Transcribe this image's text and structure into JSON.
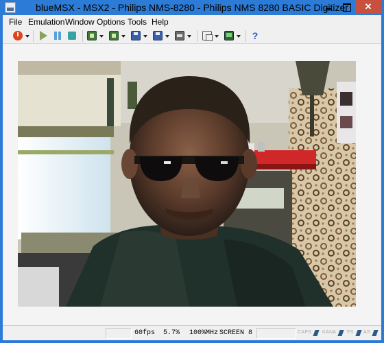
{
  "window": {
    "title": "blueMSX - MSX2 - Philips NMS-8280 - Philips NMS 8280 BASIC Digitizer",
    "app_icon": "bluemsx-icon",
    "controls": [
      "minimize-icon",
      "maximize-icon",
      "close-icon"
    ]
  },
  "menu": {
    "items": [
      {
        "label": "File"
      },
      {
        "label": "Emulation"
      },
      {
        "label": "Window"
      },
      {
        "label": "Options"
      },
      {
        "label": "Tools"
      },
      {
        "label": "Help"
      }
    ]
  },
  "toolbar": {
    "buttons": [
      {
        "icon": "power-icon",
        "dropdown": true
      },
      {
        "icon": "play-icon",
        "dropdown": false
      },
      {
        "icon": "pause-icon",
        "dropdown": false
      },
      {
        "icon": "stop-icon",
        "dropdown": false
      },
      {
        "icon": "cartridge-1-icon",
        "dropdown": true
      },
      {
        "icon": "cartridge-2-icon",
        "dropdown": true
      },
      {
        "icon": "disk-a-icon",
        "dropdown": true
      },
      {
        "icon": "disk-b-icon",
        "dropdown": true
      },
      {
        "icon": "cassette-icon",
        "dropdown": true
      },
      {
        "icon": "windows-icon",
        "dropdown": true
      },
      {
        "icon": "screen-mode-icon",
        "dropdown": true
      },
      {
        "icon": "help-icon",
        "dropdown": false
      }
    ],
    "help_glyph": "?"
  },
  "display": {
    "content": "digitized webcam image of a man wearing sunglasses"
  },
  "status": {
    "fps": "60fps",
    "cpu": "5.7%",
    "speed": "100%MHz",
    "screen_mode": "SCREEN 8",
    "leds": [
      "CAPS",
      "KANA",
      "FS",
      "AS"
    ]
  },
  "colors": {
    "titlebar": "#2c7bd6",
    "close_button": "#c7503e",
    "chrome": "#f0f0f0"
  }
}
